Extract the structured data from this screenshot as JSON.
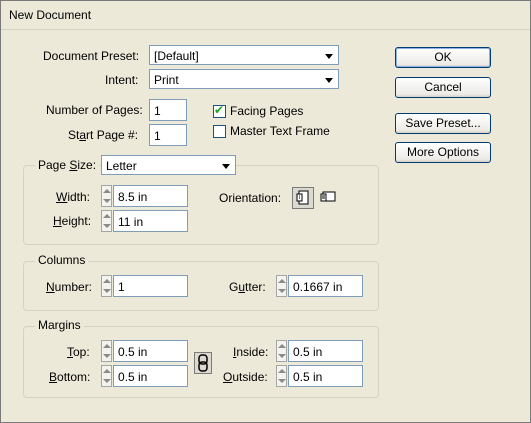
{
  "window": {
    "title": "New Document"
  },
  "document_preset": {
    "label": "Document Preset:",
    "value": "[Default]"
  },
  "intent": {
    "label": "Intent:",
    "value": "Print"
  },
  "pages": {
    "number_label": "Number of Pages:",
    "number_value": "1",
    "start_label_pre": "St",
    "start_label_u": "a",
    "start_label_post": "rt Page #:",
    "start_value": "1"
  },
  "checkboxes": {
    "facing_pages": {
      "label": "Facing Pages",
      "checked": true
    },
    "master_text_frame": {
      "label": "Master Text Frame",
      "checked": false
    }
  },
  "page_size": {
    "label_pre": "Page ",
    "label_u": "S",
    "label_post": "ize:",
    "value": "Letter",
    "width_label_u": "W",
    "width_label_post": "idth:",
    "width_value": "8.5 in",
    "height_label_u": "H",
    "height_label_post": "eight:",
    "height_value": "11 in",
    "orientation_label": "Orientation:",
    "orientation_portrait_icon": "portrait-icon",
    "orientation_landscape_icon": "landscape-icon"
  },
  "columns": {
    "title": "Columns",
    "number_label_u": "N",
    "number_label_post": "umber:",
    "number_value": "1",
    "gutter_label_pre": "G",
    "gutter_label_u": "u",
    "gutter_label_post": "tter:",
    "gutter_value": "0.1667 in"
  },
  "margins": {
    "title": "Margins",
    "top_label_u": "T",
    "top_label_post": "op:",
    "top_value": "0.5 in",
    "bottom_label_u": "B",
    "bottom_label_post": "ottom:",
    "bottom_value": "0.5 in",
    "inside_label_u": "I",
    "inside_label_post": "nside:",
    "inside_value": "0.5 in",
    "outside_label_u": "O",
    "outside_label_post": "utside:",
    "outside_value": "0.5 in",
    "link_icon": "chain-link-icon"
  },
  "buttons": {
    "ok": "OK",
    "cancel": "Cancel",
    "save_preset": "Save Preset...",
    "more_options": "More Options"
  }
}
